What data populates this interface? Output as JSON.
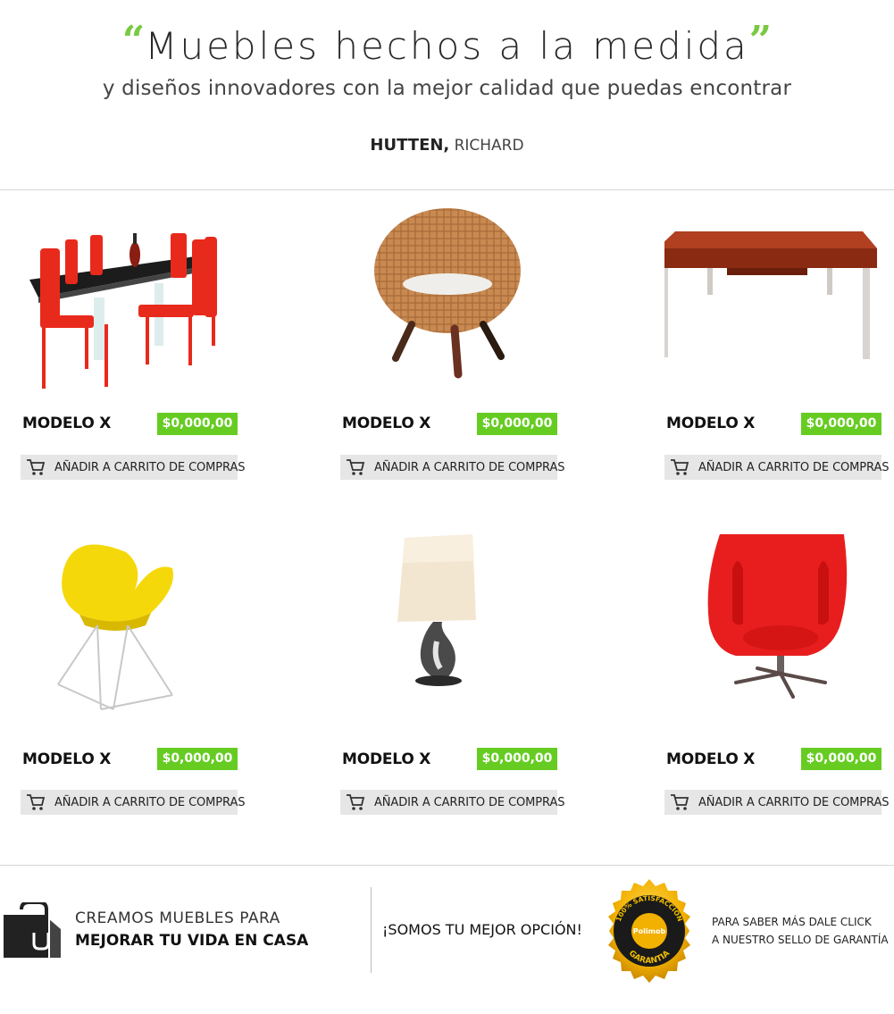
{
  "hero": {
    "open_quote": "“",
    "title": "Muebles hechos a la medida",
    "close_quote": "”",
    "subtitle": "y diseños innovadores con la mejor calidad que puedas encontrar",
    "author_last": "HUTTEN,",
    "author_first": "RICHARD"
  },
  "colors": {
    "accent_green": "#7ac943",
    "price_green": "#66cc22",
    "button_gray": "#e6e6e6"
  },
  "products": [
    {
      "image": "dining-set-icon",
      "name": "MODELO X",
      "price": "$0,000,00",
      "cart_label": "AÑADIR A CARRITO DE COMPRAS"
    },
    {
      "image": "wicker-chair-icon",
      "name": "MODELO X",
      "price": "$0,000,00",
      "cart_label": "AÑADIR A CARRITO DE COMPRAS"
    },
    {
      "image": "wood-table-icon",
      "name": "MODELO X",
      "price": "$0,000,00",
      "cart_label": "AÑADIR A CARRITO DE COMPRAS"
    },
    {
      "image": "yellow-chair-icon",
      "name": "MODELO X",
      "price": "$0,000,00",
      "cart_label": "AÑADIR A CARRITO DE COMPRAS"
    },
    {
      "image": "table-lamp-icon",
      "name": "MODELO X",
      "price": "$0,000,00",
      "cart_label": "AÑADIR A CARRITO DE COMPRAS"
    },
    {
      "image": "egg-chair-icon",
      "name": "MODELO X",
      "price": "$0,000,00",
      "cart_label": "AÑADIR A CARRITO DE COMPRAS"
    }
  ],
  "footer": {
    "line1": "CREAMOS MUEBLES PARA",
    "line2": "MEJORAR TU VIDA EN CASA",
    "slogan": "¡SOMOS TU MEJOR OPCIÓN!",
    "seal": {
      "top_text": "100% SATISFACCIÓN",
      "brand": "Polimob",
      "bottom_text": "GARANTIA"
    },
    "seal_info_1": "PARA SABER MÁS DALE CLICK",
    "seal_info_2": "A NUESTRO SELLO DE GARANTÍA"
  }
}
